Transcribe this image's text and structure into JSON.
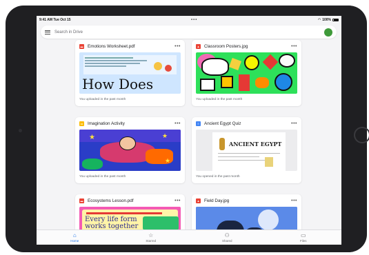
{
  "status_bar": {
    "time": "9:41 AM  Tue Oct 15",
    "dots": "•••",
    "battery": "100%"
  },
  "search": {
    "placeholder": "Search in Drive"
  },
  "files": [
    {
      "title": "Emotions Worksheet.pdf",
      "icon": "pdf-icon",
      "caption": "You uploaded in the past month",
      "thumb_text": "How Does"
    },
    {
      "title": "Classroom Posters.jpg",
      "icon": "image-icon",
      "caption": "You uploaded in the past month",
      "thumb_text": ""
    },
    {
      "title": "Imagination Activity",
      "icon": "slides-icon",
      "caption": "You uploaded in the past month",
      "thumb_text": ""
    },
    {
      "title": "Ancient Egypt Quiz",
      "icon": "doc-icon",
      "caption": "You opened in the past month",
      "thumb_text": "ANCIENT EGYPT"
    },
    {
      "title": "Ecosystems Lesson.pdf",
      "icon": "pdf-icon",
      "caption": "",
      "thumb_text": "Every life form works together"
    },
    {
      "title": "Field Day.jpg",
      "icon": "image-icon",
      "caption": "",
      "thumb_text": ""
    }
  ],
  "more_label": "•••",
  "tabs": [
    {
      "label": "Home",
      "icon": "home-icon",
      "active": true
    },
    {
      "label": "Starred",
      "icon": "star-icon",
      "active": false
    },
    {
      "label": "Shared",
      "icon": "shared-icon",
      "active": false
    },
    {
      "label": "Files",
      "icon": "folder-icon",
      "active": false
    }
  ],
  "colors": {
    "accent": "#1a73e8",
    "pdf": "#ea4335",
    "image": "#ea4335",
    "slides": "#fbbc04",
    "doc": "#4285f4",
    "avatar": "#3f9a3a"
  }
}
